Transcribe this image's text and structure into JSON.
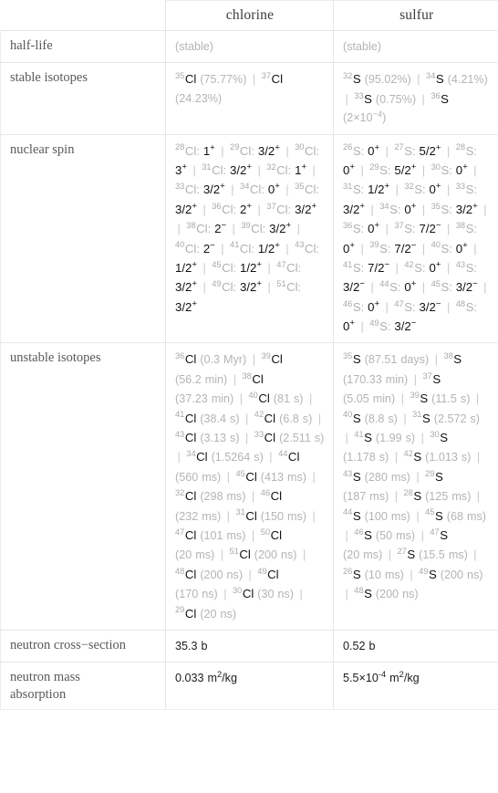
{
  "header": {
    "blank_label": "",
    "columns": [
      "chlorine",
      "sulfur"
    ]
  },
  "rows": {
    "half_life": {
      "label": "half-life",
      "chlorine": "(stable)",
      "sulfur": "(stable)"
    },
    "stable_isotopes": {
      "label": "stable isotopes",
      "chlorine": [
        {
          "mass": "35",
          "el": "Cl",
          "note": "(75.77%)"
        },
        {
          "mass": "37",
          "el": "Cl",
          "note": "(24.23%)"
        }
      ],
      "sulfur": [
        {
          "mass": "32",
          "el": "S",
          "note": "(95.02%)"
        },
        {
          "mass": "34",
          "el": "S",
          "note": "(4.21%)"
        },
        {
          "mass": "33",
          "el": "S",
          "note": "(0.75%)"
        },
        {
          "mass": "36",
          "el": "S",
          "note": "(2×10^-4)",
          "note_base": "(2×10",
          "note_exp": "-4",
          "note_tail": ")"
        }
      ]
    },
    "nuclear_spin": {
      "label": "nuclear spin",
      "chlorine": [
        {
          "mass": "28",
          "el": "Cl",
          "spin": "1",
          "sign": "+"
        },
        {
          "mass": "29",
          "el": "Cl",
          "spin": "3/2",
          "sign": "+"
        },
        {
          "mass": "30",
          "el": "Cl",
          "spin": "3",
          "sign": "+"
        },
        {
          "mass": "31",
          "el": "Cl",
          "spin": "3/2",
          "sign": "+"
        },
        {
          "mass": "32",
          "el": "Cl",
          "spin": "1",
          "sign": "+"
        },
        {
          "mass": "33",
          "el": "Cl",
          "spin": "3/2",
          "sign": "+"
        },
        {
          "mass": "34",
          "el": "Cl",
          "spin": "0",
          "sign": "+"
        },
        {
          "mass": "35",
          "el": "Cl",
          "spin": "3/2",
          "sign": "+"
        },
        {
          "mass": "36",
          "el": "Cl",
          "spin": "2",
          "sign": "+"
        },
        {
          "mass": "37",
          "el": "Cl",
          "spin": "3/2",
          "sign": "+"
        },
        {
          "mass": "38",
          "el": "Cl",
          "spin": "2",
          "sign": "-"
        },
        {
          "mass": "39",
          "el": "Cl",
          "spin": "3/2",
          "sign": "+"
        },
        {
          "mass": "40",
          "el": "Cl",
          "spin": "2",
          "sign": "-"
        },
        {
          "mass": "41",
          "el": "Cl",
          "spin": "1/2",
          "sign": "+"
        },
        {
          "mass": "43",
          "el": "Cl",
          "spin": "1/2",
          "sign": "+"
        },
        {
          "mass": "45",
          "el": "Cl",
          "spin": "1/2",
          "sign": "+"
        },
        {
          "mass": "47",
          "el": "Cl",
          "spin": "3/2",
          "sign": "+"
        },
        {
          "mass": "49",
          "el": "Cl",
          "spin": "3/2",
          "sign": "+"
        },
        {
          "mass": "51",
          "el": "Cl",
          "spin": "3/2",
          "sign": "+"
        }
      ],
      "sulfur": [
        {
          "mass": "26",
          "el": "S",
          "spin": "0",
          "sign": "+"
        },
        {
          "mass": "27",
          "el": "S",
          "spin": "5/2",
          "sign": "+"
        },
        {
          "mass": "28",
          "el": "S",
          "spin": "0",
          "sign": "+"
        },
        {
          "mass": "29",
          "el": "S",
          "spin": "5/2",
          "sign": "+"
        },
        {
          "mass": "30",
          "el": "S",
          "spin": "0",
          "sign": "+"
        },
        {
          "mass": "31",
          "el": "S",
          "spin": "1/2",
          "sign": "+"
        },
        {
          "mass": "32",
          "el": "S",
          "spin": "0",
          "sign": "+"
        },
        {
          "mass": "33",
          "el": "S",
          "spin": "3/2",
          "sign": "+"
        },
        {
          "mass": "34",
          "el": "S",
          "spin": "0",
          "sign": "+"
        },
        {
          "mass": "35",
          "el": "S",
          "spin": "3/2",
          "sign": "+"
        },
        {
          "mass": "36",
          "el": "S",
          "spin": "0",
          "sign": "+"
        },
        {
          "mass": "37",
          "el": "S",
          "spin": "7/2",
          "sign": "-"
        },
        {
          "mass": "38",
          "el": "S",
          "spin": "0",
          "sign": "+"
        },
        {
          "mass": "39",
          "el": "S",
          "spin": "7/2",
          "sign": "-"
        },
        {
          "mass": "40",
          "el": "S",
          "spin": "0",
          "sign": "+"
        },
        {
          "mass": "41",
          "el": "S",
          "spin": "7/2",
          "sign": "-"
        },
        {
          "mass": "42",
          "el": "S",
          "spin": "0",
          "sign": "+"
        },
        {
          "mass": "43",
          "el": "S",
          "spin": "3/2",
          "sign": "-"
        },
        {
          "mass": "44",
          "el": "S",
          "spin": "0",
          "sign": "+"
        },
        {
          "mass": "45",
          "el": "S",
          "spin": "3/2",
          "sign": "-"
        },
        {
          "mass": "46",
          "el": "S",
          "spin": "0",
          "sign": "+"
        },
        {
          "mass": "47",
          "el": "S",
          "spin": "3/2",
          "sign": "-"
        },
        {
          "mass": "48",
          "el": "S",
          "spin": "0",
          "sign": "+"
        },
        {
          "mass": "49",
          "el": "S",
          "spin": "3/2",
          "sign": "-"
        }
      ]
    },
    "unstable_isotopes": {
      "label": "unstable isotopes",
      "chlorine": [
        {
          "mass": "36",
          "el": "Cl",
          "note": "(0.3 Myr)"
        },
        {
          "mass": "39",
          "el": "Cl",
          "note": "(56.2 min)"
        },
        {
          "mass": "38",
          "el": "Cl",
          "note": "(37.23 min)"
        },
        {
          "mass": "40",
          "el": "Cl",
          "note": "(81 s)"
        },
        {
          "mass": "41",
          "el": "Cl",
          "note": "(38.4 s)"
        },
        {
          "mass": "42",
          "el": "Cl",
          "note": "(6.8 s)"
        },
        {
          "mass": "43",
          "el": "Cl",
          "note": "(3.13 s)"
        },
        {
          "mass": "33",
          "el": "Cl",
          "note": "(2.511 s)"
        },
        {
          "mass": "34",
          "el": "Cl",
          "note": "(1.5264 s)"
        },
        {
          "mass": "44",
          "el": "Cl",
          "note": "(560 ms)"
        },
        {
          "mass": "45",
          "el": "Cl",
          "note": "(413 ms)"
        },
        {
          "mass": "32",
          "el": "Cl",
          "note": "(298 ms)"
        },
        {
          "mass": "46",
          "el": "Cl",
          "note": "(232 ms)"
        },
        {
          "mass": "31",
          "el": "Cl",
          "note": "(150 ms)"
        },
        {
          "mass": "47",
          "el": "Cl",
          "note": "(101 ms)"
        },
        {
          "mass": "50",
          "el": "Cl",
          "note": "(20 ms)"
        },
        {
          "mass": "51",
          "el": "Cl",
          "note": "(200 ns)"
        },
        {
          "mass": "48",
          "el": "Cl",
          "note": "(200 ns)"
        },
        {
          "mass": "49",
          "el": "Cl",
          "note": "(170 ns)"
        },
        {
          "mass": "30",
          "el": "Cl",
          "note": "(30 ns)"
        },
        {
          "mass": "29",
          "el": "Cl",
          "note": "(20 ns)"
        }
      ],
      "sulfur": [
        {
          "mass": "35",
          "el": "S",
          "note": "(87.51 days)"
        },
        {
          "mass": "38",
          "el": "S",
          "note": "(170.33 min)"
        },
        {
          "mass": "37",
          "el": "S",
          "note": "(5.05 min)"
        },
        {
          "mass": "39",
          "el": "S",
          "note": "(11.5 s)"
        },
        {
          "mass": "40",
          "el": "S",
          "note": "(8.8 s)"
        },
        {
          "mass": "31",
          "el": "S",
          "note": "(2.572 s)"
        },
        {
          "mass": "41",
          "el": "S",
          "note": "(1.99 s)"
        },
        {
          "mass": "30",
          "el": "S",
          "note": "(1.178 s)"
        },
        {
          "mass": "42",
          "el": "S",
          "note": "(1.013 s)"
        },
        {
          "mass": "43",
          "el": "S",
          "note": "(280 ms)"
        },
        {
          "mass": "29",
          "el": "S",
          "note": "(187 ms)"
        },
        {
          "mass": "28",
          "el": "S",
          "note": "(125 ms)"
        },
        {
          "mass": "44",
          "el": "S",
          "note": "(100 ms)"
        },
        {
          "mass": "45",
          "el": "S",
          "note": "(68 ms)"
        },
        {
          "mass": "46",
          "el": "S",
          "note": "(50 ms)"
        },
        {
          "mass": "47",
          "el": "S",
          "note": "(20 ms)"
        },
        {
          "mass": "27",
          "el": "S",
          "note": "(15.5 ms)"
        },
        {
          "mass": "26",
          "el": "S",
          "note": "(10 ms)"
        },
        {
          "mass": "49",
          "el": "S",
          "note": "(200 ns)"
        },
        {
          "mass": "48",
          "el": "S",
          "note": "(200 ns)"
        }
      ]
    },
    "neutron_cross_section": {
      "label": "neutron cross−section",
      "chlorine": "35.3 b",
      "sulfur": "0.52 b"
    },
    "neutron_mass_absorption": {
      "label": "neutron mass\nabsorption",
      "chlorine_base": "0.033 m",
      "chlorine_exp": "2",
      "chlorine_tail": "/kg",
      "sulfur_base": "5.5×10",
      "sulfur_exp": "-4",
      "sulfur_mid": " m",
      "sulfur_exp2": "2",
      "sulfur_tail": "/kg"
    }
  },
  "colors": {
    "border": "#e6e6e6",
    "label_text": "#5a5a5a",
    "value_text": "#1b1b1b",
    "muted_text": "#b4b4b4",
    "separator": "#c9c9c9"
  }
}
